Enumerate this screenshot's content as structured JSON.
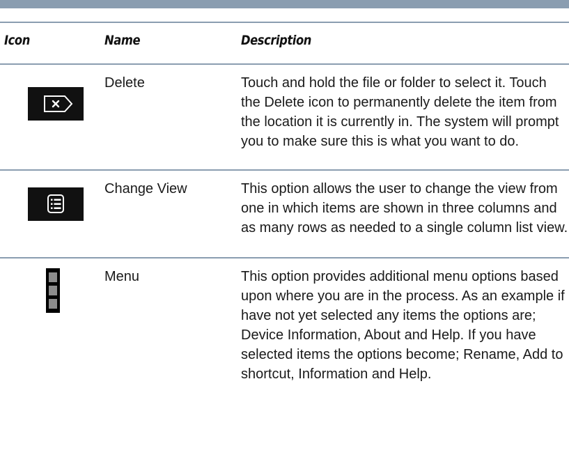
{
  "table": {
    "headers": {
      "icon": "Icon",
      "name": "Name",
      "description": "Description"
    },
    "rows": [
      {
        "icon": "delete-icon",
        "name": "Delete",
        "description": "Touch and hold the file or folder to select it. Touch the Delete icon to permanently delete the item from the location it is currently in. The system will prompt you to make sure this is what you want to do."
      },
      {
        "icon": "change-view-icon",
        "name": "Change View",
        "description": "This option allows the user to change the view from one in which items are shown in three columns and as many rows as needed to a single column list view."
      },
      {
        "icon": "menu-icon",
        "name": "Menu",
        "description": "This option provides additional menu options based upon where you are in the process. As an example if have not yet selected any items the options are; Device Information, About and Help. If you have selected items the options become; Rename, Add to shortcut, Information and Help."
      }
    ]
  },
  "colors": {
    "rule": "#8a9db0",
    "icon_bg": "#111111",
    "icon_fg": "#ffffff",
    "menu_dot": "#8c8c8c"
  }
}
